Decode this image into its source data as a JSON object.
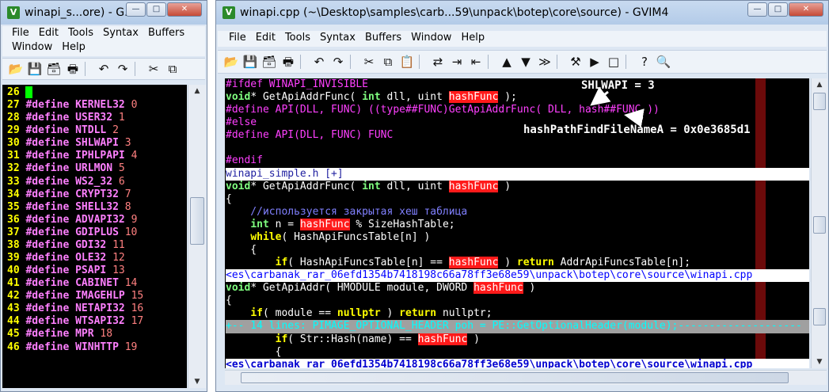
{
  "left_window": {
    "title": "winapi_s...ore) - G...",
    "menu": [
      "File",
      "Edit",
      "Tools",
      "Syntax",
      "Buffers",
      "Window",
      "Help"
    ],
    "toolbar_icons": [
      "open-icon",
      "save-icon",
      "save-all-icon",
      "print-icon",
      "undo-icon",
      "redo-icon",
      "cut-icon",
      "copy-icon"
    ],
    "lines": [
      {
        "n": "26",
        "name": "",
        "val": ""
      },
      {
        "n": "27",
        "name": "KERNEL32",
        "val": "0"
      },
      {
        "n": "28",
        "name": "USER32",
        "val": "1"
      },
      {
        "n": "29",
        "name": "NTDLL",
        "val": "2"
      },
      {
        "n": "30",
        "name": "SHLWAPI",
        "val": "3"
      },
      {
        "n": "31",
        "name": "IPHLPAPI",
        "val": "4"
      },
      {
        "n": "32",
        "name": "URLMON",
        "val": "5"
      },
      {
        "n": "33",
        "name": "WS2_32",
        "val": "6"
      },
      {
        "n": "34",
        "name": "CRYPT32",
        "val": "7"
      },
      {
        "n": "35",
        "name": "SHELL32",
        "val": "8"
      },
      {
        "n": "36",
        "name": "ADVAPI32",
        "val": "9"
      },
      {
        "n": "37",
        "name": "GDIPLUS",
        "val": "10"
      },
      {
        "n": "38",
        "name": "GDI32",
        "val": "11"
      },
      {
        "n": "39",
        "name": "OLE32",
        "val": "12"
      },
      {
        "n": "40",
        "name": "PSAPI",
        "val": "13"
      },
      {
        "n": "41",
        "name": "CABINET",
        "val": "14"
      },
      {
        "n": "42",
        "name": "IMAGEHLP",
        "val": "15"
      },
      {
        "n": "43",
        "name": "NETAPI32",
        "val": "16"
      },
      {
        "n": "44",
        "name": "WTSAPI32",
        "val": "17"
      },
      {
        "n": "45",
        "name": "MPR",
        "val": "18"
      },
      {
        "n": "46",
        "name": "WINHTTP",
        "val": "19"
      }
    ],
    "define_kw": "#define"
  },
  "right_window": {
    "title": "winapi.cpp (~\\Desktop\\samples\\carb...59\\unpack\\botep\\core\\source) - GVIM4",
    "menu": [
      "File",
      "Edit",
      "Tools",
      "Syntax",
      "Buffers",
      "Window",
      "Help"
    ],
    "toolbar_icons": [
      "open-icon",
      "save-icon",
      "save-all-icon",
      "print-icon",
      "undo-icon",
      "redo-icon",
      "cut-icon",
      "copy-icon",
      "paste-icon",
      "replace-icon",
      "find-next-icon",
      "find-prev-icon",
      "load-session-icon",
      "save-session-icon",
      "run-script-icon",
      "make-icon",
      "shell-icon",
      "tags-icon",
      "help-icon",
      "find-help-icon"
    ],
    "annotations": {
      "shlwapi": "SHLWAPI = 3",
      "hash": "hashPathFindFileNameA = 0x0e3685d1"
    },
    "code": {
      "l1": "#ifdef WINAPI_INVISIBLE",
      "l2a": "void",
      "l2b": "* GetApiAddrFunc( ",
      "l2c": "int",
      "l2d": " dll, uint ",
      "l2e": "hashFunc",
      "l2f": " );",
      "l3": "#define API(DLL, FUNC) ((type##FUNC)GetApiAddrFunc( DLL, hash##FUNC ))",
      "l4": "#else",
      "l5": "#define API(DLL, FUNC) FUNC",
      "l6": "",
      "l7": "#endif",
      "status1": "winapi_simple.h [+]",
      "l8a": "void",
      "l8b": "* GetApiAddrFunc( ",
      "l8c": "int",
      "l8d": " dll, uint ",
      "l8e": "hashFunc",
      "l8f": " )",
      "l9": "{",
      "l10": "    //используется закрытая хеш таблица",
      "l11a": "    ",
      "l11b": "int",
      "l11c": " n = ",
      "l11d": "hashFunc",
      "l11e": " % SizeHashTable;",
      "l12a": "    ",
      "l12b": "while",
      "l12c": "( HashApiFuncsTable[n] )",
      "l13": "    {",
      "l14a": "        ",
      "l14b": "if",
      "l14c": "( HashApiFuncsTable[n] == ",
      "l14d": "hashFunc",
      "l14e": " ) ",
      "l14f": "return",
      "l14g": " AddrApiFuncsTable[n];",
      "status2": "<es\\carbanak_rar_06efd1354b7418198c66a78ff3e68e59\\unpack\\botep\\core\\source\\winapi.cpp",
      "l15a": "void",
      "l15b": "* GetApiAddr( HMODULE module, DWORD ",
      "l15c": "hashFunc",
      "l15d": " )",
      "l16": "{",
      "l17a": "    ",
      "l17b": "if",
      "l17c": "( module == ",
      "l17d": "nullptr",
      "l17e": " ) ",
      "l17f": "return",
      "l17g": " nullptr;",
      "fold": "+-- 14 lines: PIMAGE_OPTIONAL_HEADER poh = PE::GetOptionalHeader(module);--------------------",
      "l18a": "        ",
      "l18b": "if",
      "l18c": "( Str::Hash(name) == ",
      "l18d": "hashFunc",
      "l18e": " )",
      "l19": "        {",
      "status3": "<es\\carbanak_rar_06efd1354b7418198c66a78ff3e68e59\\unpack\\botep\\core\\source\\winapi.cpp"
    }
  },
  "window_controls": {
    "min": "—",
    "max": "□",
    "close": "✕"
  }
}
